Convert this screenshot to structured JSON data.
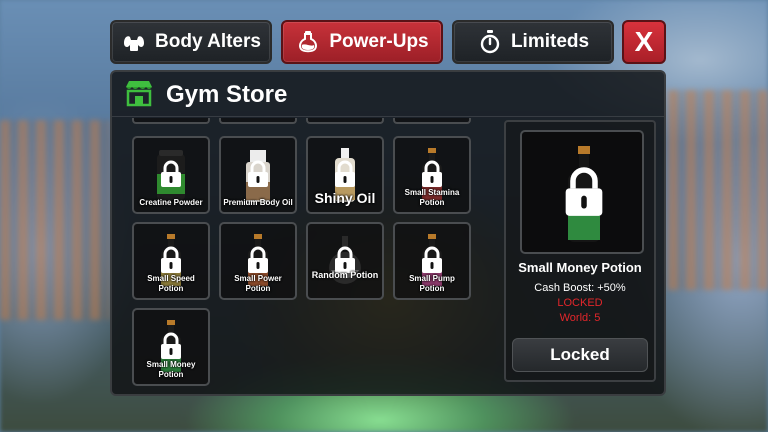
{
  "tabs": [
    {
      "label": "Body Alters",
      "icon": "muscle-icon"
    },
    {
      "label": "Power-Ups",
      "icon": "potion-flask-icon",
      "active": true
    },
    {
      "label": "Limiteds",
      "icon": "stopwatch-icon"
    }
  ],
  "close_label": "X",
  "window": {
    "title": "Gym Store",
    "icon": "store-icon"
  },
  "items": [
    {
      "label": "Creatine Powder",
      "locked": true
    },
    {
      "label": "Premium Body Oil",
      "locked": true
    },
    {
      "label": "Shiny Oil",
      "locked": true
    },
    {
      "label": "Small Stamina Potion",
      "locked": true
    },
    {
      "label": "Small Speed Potion",
      "locked": true
    },
    {
      "label": "Small Power Potion",
      "locked": true
    },
    {
      "label": "Random Potion",
      "locked": true
    },
    {
      "label": "Small Pump Potion",
      "locked": true
    },
    {
      "label": "Small Money Potion",
      "locked": true
    }
  ],
  "detail": {
    "name": "Small Money Potion",
    "boost": "Cash Boost: +50%",
    "status": "LOCKED",
    "world": "World: 5",
    "button_label": "Locked"
  },
  "colors": {
    "accent_red": "#c8323a",
    "locked_text": "#e3262b",
    "store_icon": "#3fbf3f"
  }
}
